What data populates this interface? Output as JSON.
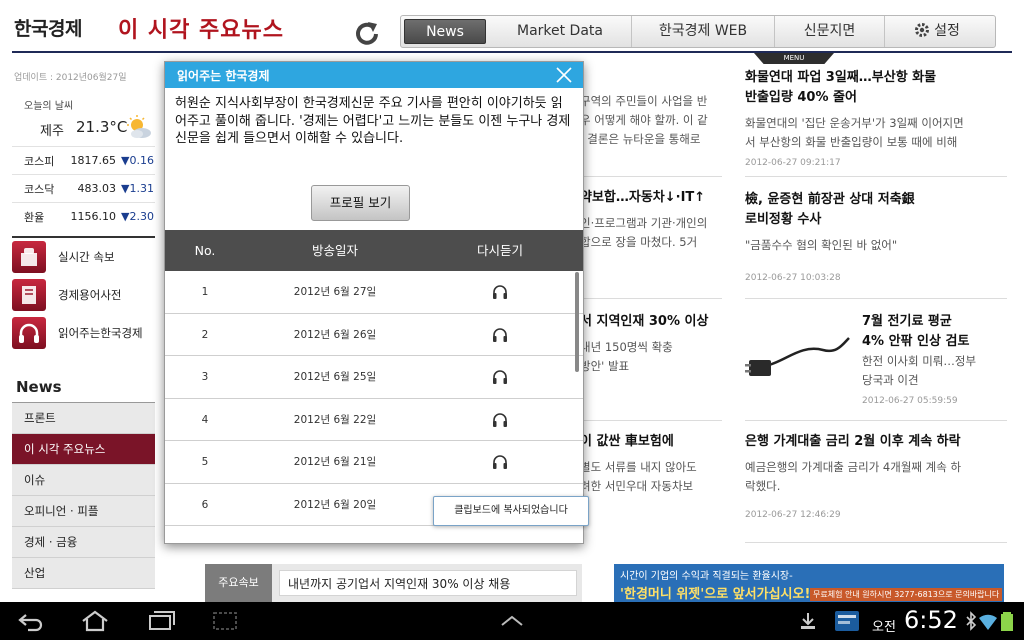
{
  "header": {
    "brand": "한국경제",
    "section_title": "이 시각 주요뉴스",
    "tabs": [
      "News",
      "Market Data",
      "한국경제 WEB",
      "신문지면",
      "설정"
    ],
    "menu_label": "MENU"
  },
  "sidebar": {
    "update_text": "업데이트 : 2012년06월27일",
    "weather_label": "오늘의 날씨",
    "weather_city": "제주",
    "weather_temp": "21.3°C",
    "indices": [
      {
        "name": "코스피",
        "value": "1817.65",
        "change": "▼0.16"
      },
      {
        "name": "코스닥",
        "value": "483.03",
        "change": "▼1.31"
      },
      {
        "name": "환율",
        "value": "1156.10",
        "change": "▼2.30"
      }
    ],
    "tools": [
      "실시간 속보",
      "경제용어사전",
      "읽어주는한국경제"
    ],
    "news_heading": "News",
    "nav": [
      "프론트",
      "이 시각 주요뉴스",
      "이슈",
      "오피니언 · 피플",
      "경제 · 금융",
      "산업"
    ]
  },
  "articles": {
    "left_fragments": [
      {
        "title": "",
        "summary": "구역의 주민들이 사업을 반\n우 어떻게 해야 할까. 이 같\n, 결론은 뉴타운을 통해로"
      },
      {
        "title": "약보합…자동차↓·IT↑",
        "summary": "인·프로그램과 기관·개인의\n합으로 장을 마쳤다. 5거"
      },
      {
        "title": "서 지역인재 30% 이상",
        "summary": "내년 150명씩 확충\n방안' 발표"
      },
      {
        "title": "이 값싼 車보험에",
        "summary": "별도 서류를 내지 않아도\n려한 서민우대 자동차보"
      }
    ],
    "right": [
      {
        "title": "화물연대 파업 3일째…부산항 화물\n반출입량 40% 줄어",
        "summary": "화물연대의 '집단 운송거부'가 3일째 이어지면\n서 부산항의 화물 반출입량이 보통 때에 비해",
        "date": "2012-06-27 09:21:17"
      },
      {
        "title": "檢, 윤증현 前장관 상대 저축銀\n로비정황 수사",
        "summary": "\"금품수수 혐의 확인된 바 없어\"",
        "date": "2012-06-27 10:03:28"
      },
      {
        "title": "7월 전기료 평균\n4% 안팎 인상 검토",
        "summary": "한전 이사회 미뤄…정부\n당국과 이견",
        "date": "2012-06-27 05:59:59"
      },
      {
        "title": "은행 가계대출 금리 2월 이후 계속 하락",
        "summary": "예금은행의 가계대출 금리가 4개월째 계속 하\n락했다.",
        "date": "2012-06-27 12:46:29"
      }
    ]
  },
  "breaking": {
    "label": "주요속보",
    "text": "내년까지 공기업서 지역인재 30% 이상 채용"
  },
  "ad": {
    "line1": "시간이 기업의 수익과 직결되는 환율시장-",
    "line2": "'한경머니 위젯'으로 앞서가십시오!",
    "sub": "무료체험 안내 원하시면 3277-6813으로 문의바랍니다"
  },
  "dialog": {
    "title": "읽어주는 한국경제",
    "description": "허원순 지식사회부장이 한국경제신문 주요 기사를 편안히 이야기하듯 읽어주고 풀이해 줍니다. '경제는 어렵다'고 느끼는 분들도 이젠 누구나 경제신문을 쉽게 들으면서 이해할 수 있습니다.",
    "profile_button": "프로필 보기",
    "columns": [
      "No.",
      "방송일자",
      "다시듣기"
    ],
    "episodes": [
      {
        "no": "1",
        "date": "2012년 6월 27일"
      },
      {
        "no": "2",
        "date": "2012년 6월 26일"
      },
      {
        "no": "3",
        "date": "2012년 6월 25일"
      },
      {
        "no": "4",
        "date": "2012년 6월 22일"
      },
      {
        "no": "5",
        "date": "2012년 6월 21일"
      },
      {
        "no": "6",
        "date": "2012년 6월 20일"
      }
    ]
  },
  "toast": "클립보드에 복사되었습니다",
  "system": {
    "ampm": "오전",
    "time": "6:52"
  },
  "colors": {
    "accent_red": "#b0141e",
    "nav_active": "#7a1428",
    "dialog_header": "#2ea6e0",
    "header_rule": "#1f2a57"
  }
}
